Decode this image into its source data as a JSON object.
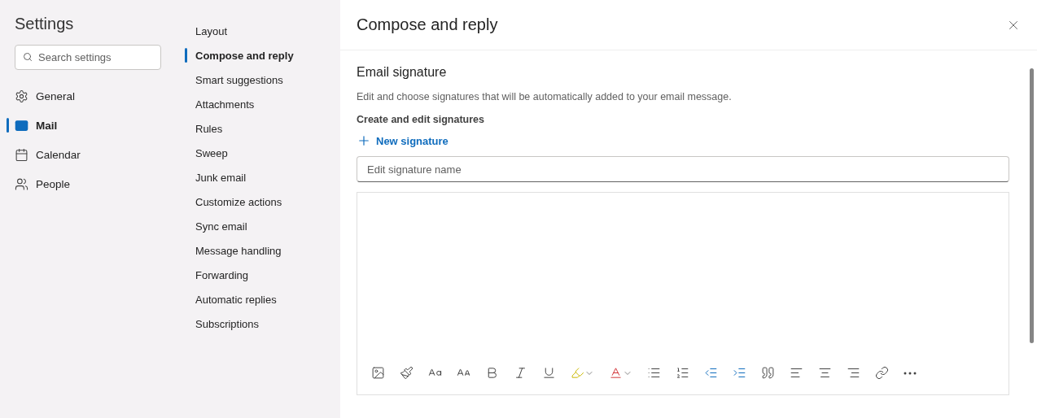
{
  "sidebar": {
    "title": "Settings",
    "search": {
      "placeholder": "Search settings"
    },
    "items": [
      {
        "label": "General",
        "selected": false
      },
      {
        "label": "Mail",
        "selected": true
      },
      {
        "label": "Calendar",
        "selected": false
      },
      {
        "label": "People",
        "selected": false
      }
    ]
  },
  "subnav": {
    "items": [
      {
        "label": "Layout",
        "selected": false
      },
      {
        "label": "Compose and reply",
        "selected": true
      },
      {
        "label": "Smart suggestions",
        "selected": false
      },
      {
        "label": "Attachments",
        "selected": false
      },
      {
        "label": "Rules",
        "selected": false
      },
      {
        "label": "Sweep",
        "selected": false
      },
      {
        "label": "Junk email",
        "selected": false
      },
      {
        "label": "Customize actions",
        "selected": false
      },
      {
        "label": "Sync email",
        "selected": false
      },
      {
        "label": "Message handling",
        "selected": false
      },
      {
        "label": "Forwarding",
        "selected": false
      },
      {
        "label": "Automatic replies",
        "selected": false
      },
      {
        "label": "Subscriptions",
        "selected": false
      }
    ]
  },
  "panel": {
    "title": "Compose and reply",
    "section": {
      "heading": "Email signature",
      "description": "Edit and choose signatures that will be automatically added to your email message.",
      "subheading": "Create and edit signatures",
      "new_button": "New signature",
      "name_field": {
        "placeholder": "Edit signature name"
      }
    }
  }
}
